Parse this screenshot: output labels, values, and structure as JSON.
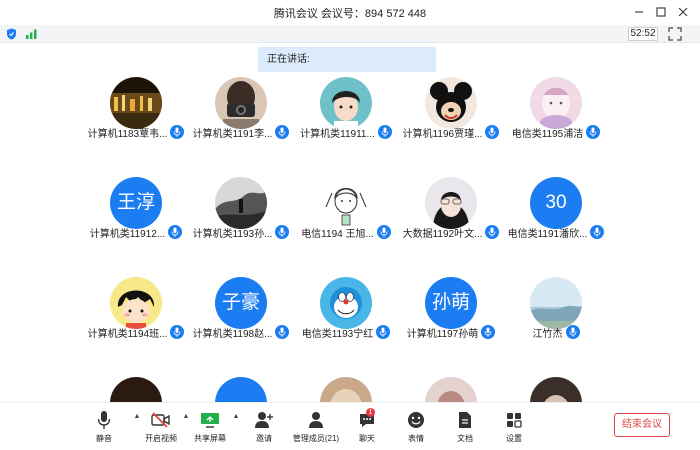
{
  "window": {
    "title": "腾讯会议  会议号：894 572 448",
    "controls": [
      "minimize",
      "maximize",
      "close"
    ]
  },
  "info": {
    "timer": "52:52"
  },
  "speaking": {
    "label": "正在讲话:"
  },
  "participants": [
    {
      "name": "计算机1183覃韦...",
      "avatar": "photo-night"
    },
    {
      "name": "计算机类1191李...",
      "avatar": "photo-camera"
    },
    {
      "name": "计算机类11911...",
      "avatar": "photo-cartoon-boy"
    },
    {
      "name": "计算机1196贾瑾...",
      "avatar": "photo-mickey"
    },
    {
      "name": "电信类1195浦洁",
      "avatar": "photo-pink"
    },
    {
      "name": "计算机类11912...",
      "avatar": "text",
      "avatar_text": "王淳"
    },
    {
      "name": "计算机类1193孙...",
      "avatar": "photo-bw"
    },
    {
      "name": "电信1194 王旭...",
      "avatar": "photo-sketch"
    },
    {
      "name": "大数据1192叶文...",
      "avatar": "photo-girl"
    },
    {
      "name": "电信类1191潘欣...",
      "avatar": "text",
      "avatar_text": "30"
    },
    {
      "name": "计算机类1194班...",
      "avatar": "photo-chibi"
    },
    {
      "name": "计算机类1198赵...",
      "avatar": "text",
      "avatar_text": "子豪"
    },
    {
      "name": "电信类1193宁红",
      "avatar": "photo-doraemon"
    },
    {
      "name": "计算机1197孙萌",
      "avatar": "text",
      "avatar_text": "孙萌"
    },
    {
      "name": "江竹杰",
      "avatar": "photo-landscape"
    }
  ],
  "toolbar": {
    "mute": "静音",
    "video": "开启视频",
    "share": "共享屏幕",
    "invite": "邀请",
    "members": "管理成员(21)",
    "chat": "聊天",
    "chat_badge": "1",
    "reaction": "表情",
    "docs": "文档",
    "settings": "设置",
    "end": "结束会议"
  },
  "colors": {
    "accent": "#1c7cf2",
    "danger": "#e04848"
  }
}
